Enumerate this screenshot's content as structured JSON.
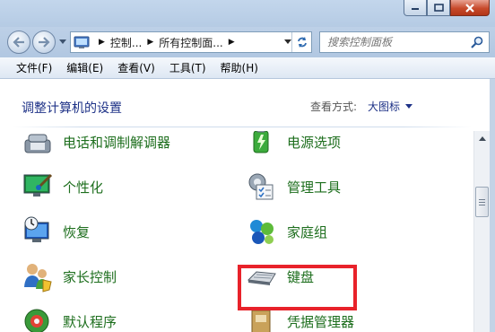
{
  "window": {
    "minimize_icon": "minimize-icon",
    "maximize_icon": "maximize-icon",
    "close_icon": "close-icon"
  },
  "nav": {
    "breadcrumbs": [
      "控制...",
      "所有控制面...",
      ""
    ],
    "search_placeholder": "搜索控制面板"
  },
  "menu": [
    "文件(F)",
    "编辑(E)",
    "查看(V)",
    "工具(T)",
    "帮助(H)"
  ],
  "page": {
    "title": "调整计算机的设置",
    "view_by_label": "查看方式:",
    "view_by_value": "大图标"
  },
  "items": [
    {
      "label": "电话和调制解调器",
      "icon": "phone-modem-icon"
    },
    {
      "label": "电源选项",
      "icon": "power-options-icon"
    },
    {
      "label": "个性化",
      "icon": "personalization-icon"
    },
    {
      "label": "管理工具",
      "icon": "admin-tools-icon"
    },
    {
      "label": "恢复",
      "icon": "recovery-icon"
    },
    {
      "label": "家庭组",
      "icon": "homegroup-icon"
    },
    {
      "label": "家长控制",
      "icon": "parental-controls-icon"
    },
    {
      "label": "键盘",
      "icon": "keyboard-icon"
    },
    {
      "label": "默认程序",
      "icon": "default-programs-icon"
    },
    {
      "label": "凭据管理器",
      "icon": "credential-manager-icon"
    }
  ],
  "colors": {
    "highlight": "#e8222a",
    "link_green": "#1d6e1d",
    "title_blue": "#1e3287"
  }
}
